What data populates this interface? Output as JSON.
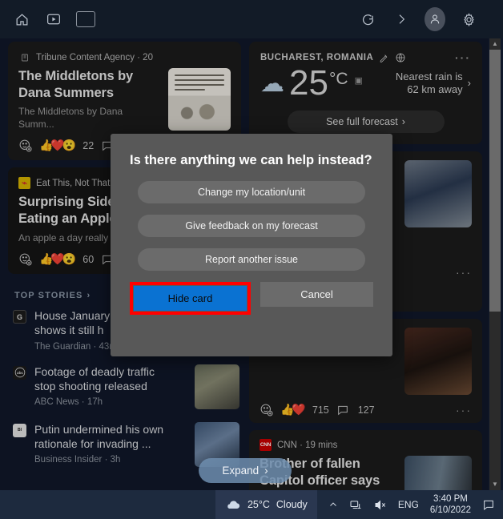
{
  "topbar": {
    "home_label": "Home",
    "video_label": "Video",
    "flag_label": "Ukraine",
    "refresh_label": "Refresh",
    "forward_label": "Forward",
    "profile_label": "Profile",
    "settings_label": "Settings"
  },
  "cards": {
    "comic": {
      "source": "Tribune Content Agency · 20",
      "title": "The Middletons by Dana Summers",
      "subtitle": "The Middletons by Dana Summ...",
      "reaction_count": "22"
    },
    "apple": {
      "source": "Eat This, Not That",
      "source_logo_glyph": "⌁",
      "title_line1": "Surprising Side",
      "title_line2": "Eating an Apple",
      "subtitle": "An apple a day really ...",
      "reaction_count": "60"
    },
    "cowboys": {
      "reaction_count": "715",
      "comment_count": "127"
    },
    "cnn": {
      "source": "CNN · 19 mins",
      "source_logo": "CNN",
      "title": "Brother of fallen Capitol officer says he wants to see Trump in prison"
    }
  },
  "weather_card": {
    "location": "BUCHAREST, ROMANIA",
    "edit_icon": "pencil-icon",
    "globe_icon": "globe-icon",
    "menu": "···",
    "temperature": "25",
    "unit": "°C",
    "rain_line1": "Nearest rain is",
    "rain_line2": "62 km away",
    "forecast_button": "See full forecast",
    "chevron": "›"
  },
  "top_stories": {
    "header": "TOP STORIES",
    "header_chevron": "›",
    "items": [
      {
        "title_line1": "House January",
        "title_line2": "shows it still h",
        "source": "The Guardian · 43m",
        "logo": "G"
      },
      {
        "title_line1": "Footage of deadly traffic",
        "title_line2": "stop shooting released",
        "source": "ABC News · 17h",
        "logo": "abc"
      },
      {
        "title_line1": "Putin undermined his own",
        "title_line2": "rationale for invading ...",
        "source": "Business Insider · 3h",
        "logo": "BI"
      }
    ]
  },
  "dialog": {
    "title": "Is there anything we can help instead?",
    "options": [
      "Change my location/unit",
      "Give feedback on my forecast",
      "Report another issue"
    ],
    "primary_button": "Hide card",
    "secondary_button": "Cancel",
    "highlight_color": "#ff0000",
    "primary_color": "#0a72d2"
  },
  "expand_button": {
    "label": "Expand",
    "chevron": "›"
  },
  "taskbar": {
    "weather_temp": "25°C",
    "weather_desc": "Cloudy",
    "show_hidden_icons": "^",
    "network_icon": "network-icon",
    "volume_icon": "volume-muted-icon",
    "language": "ENG",
    "time": "3:40 PM",
    "date": "6/10/2022",
    "notifications_icon": "notification-icon"
  }
}
